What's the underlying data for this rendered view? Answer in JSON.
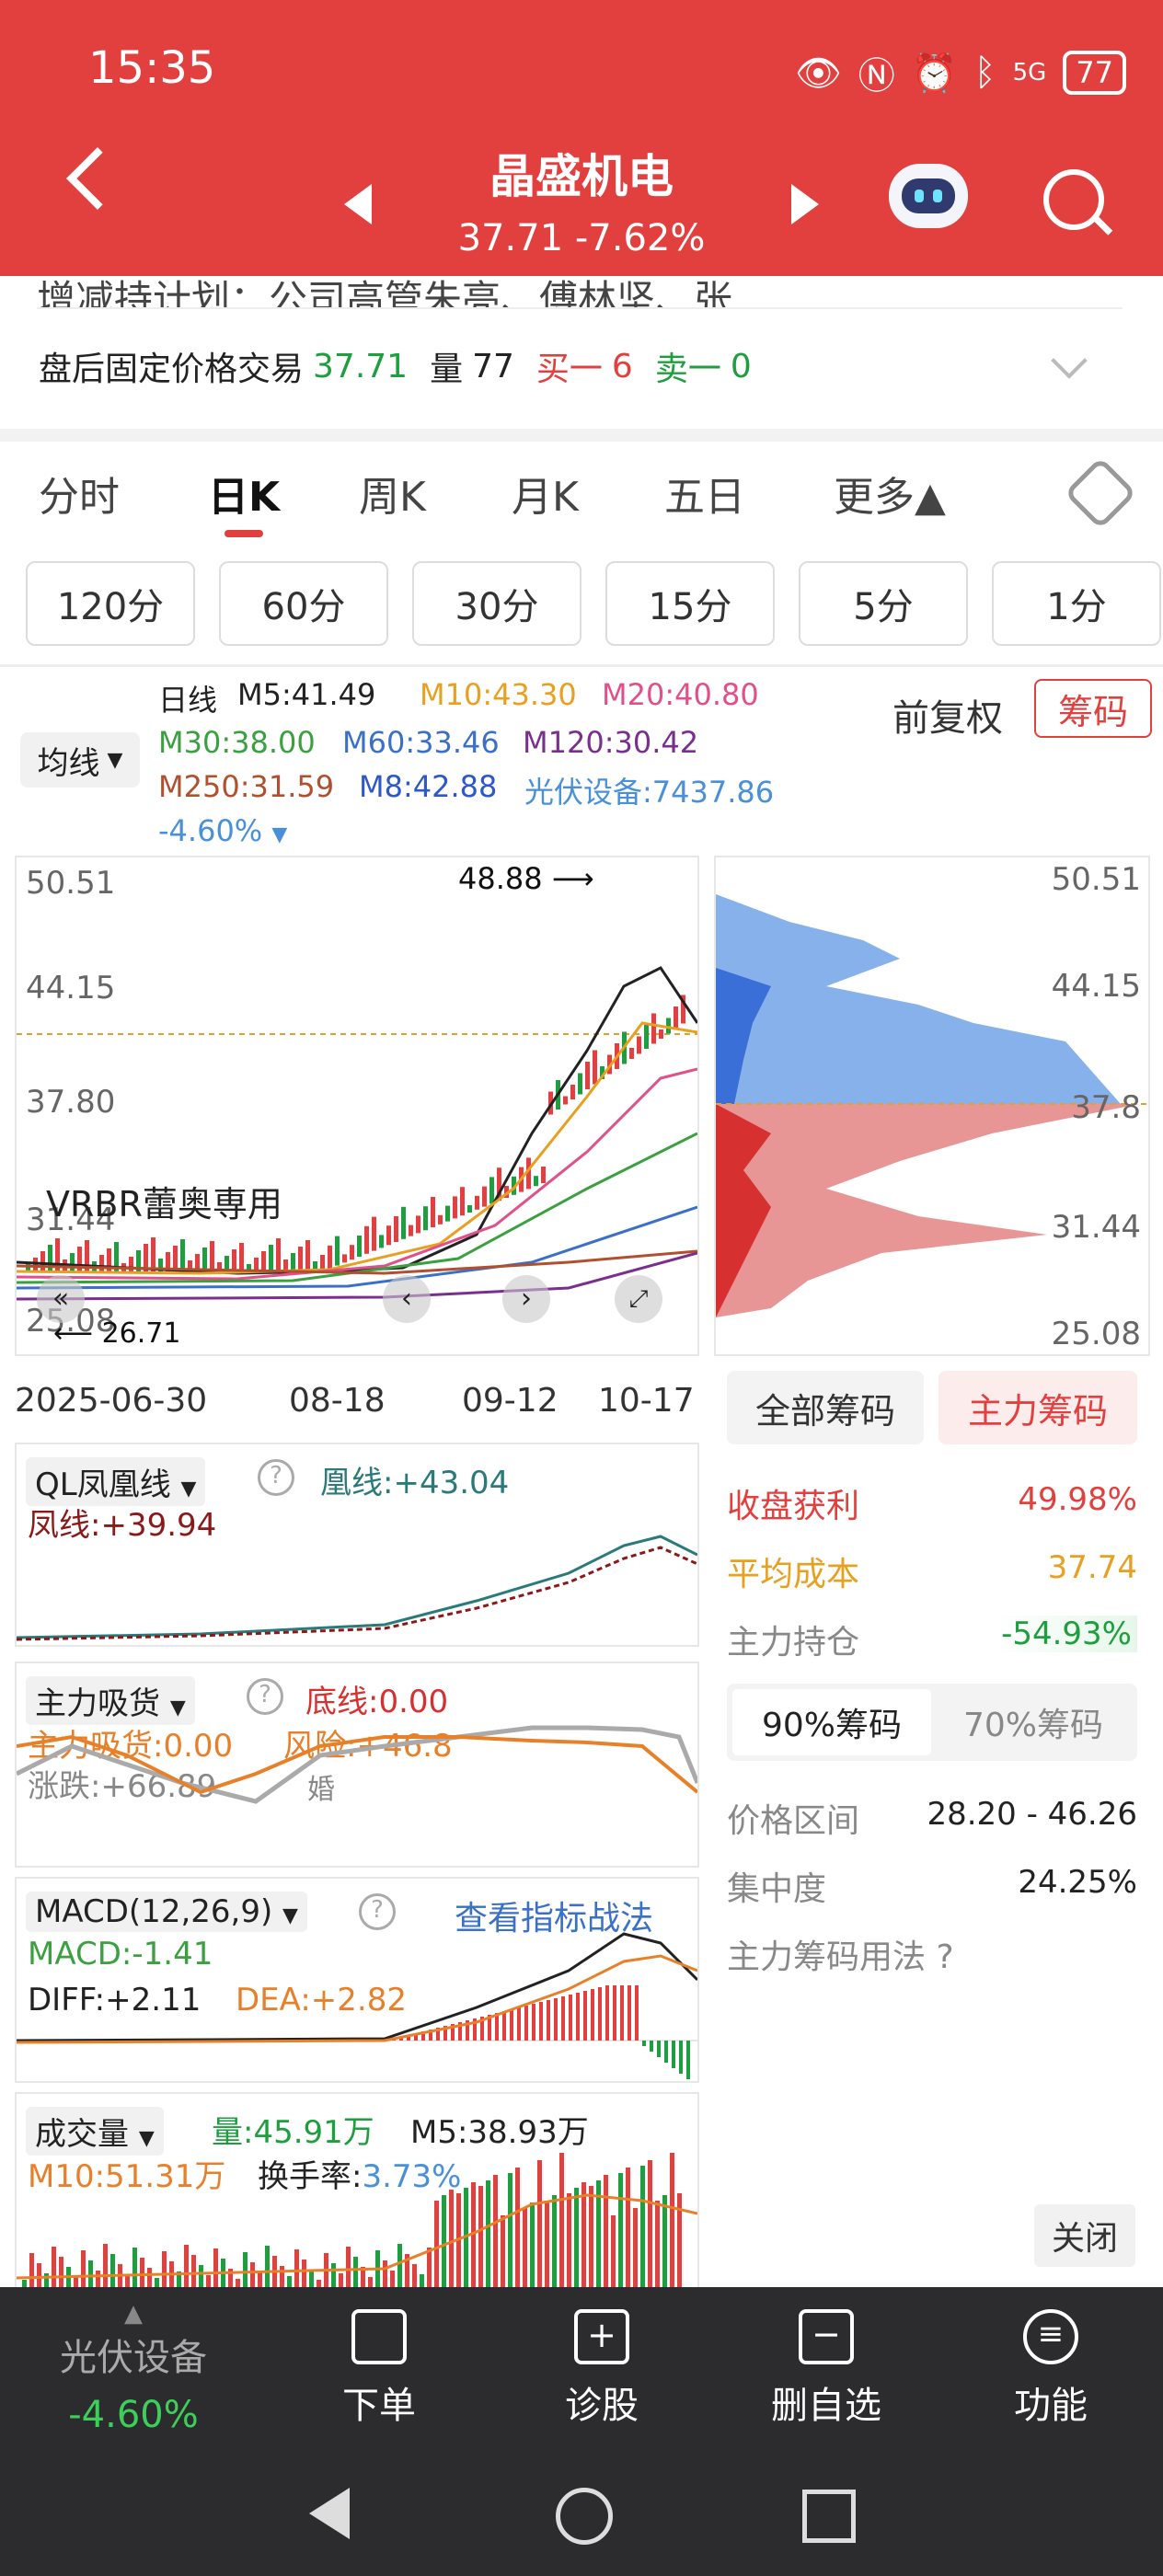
{
  "status": {
    "time": "15:35",
    "battery": "77",
    "signal": "5G"
  },
  "header": {
    "title": "晶盛机电",
    "price_change": "37.71 -7.62%"
  },
  "news": {
    "text": "增减持计划：公司高管朱亮、傅林坚、张..."
  },
  "after_hours": {
    "label": "盘后固定价格交易",
    "price": "37.71",
    "vol_label": "量",
    "vol": "77",
    "buy_label": "买一",
    "buy": "6",
    "sell_label": "卖一",
    "sell": "0"
  },
  "tabs": [
    "分时",
    "日K",
    "周K",
    "月K",
    "五日",
    "更多▲"
  ],
  "minute_buttons": [
    "120分",
    "60分",
    "30分",
    "15分",
    "5分",
    "1分"
  ],
  "ma_selector": "均线",
  "legend": {
    "daily": "日线",
    "m5": "M5:41.49",
    "m10": "M10:43.30",
    "m20": "M20:40.80",
    "m30": "M30:38.00",
    "m60": "M60:33.46",
    "m120": "M120:30.42",
    "m250": "M250:31.59",
    "m8": "M8:42.88",
    "sector": "光伏设备:7437.86",
    "sector_chg": "-4.60%"
  },
  "adjust_label": "前复权",
  "chips_button": "筹码",
  "kline": {
    "y_ticks": [
      "50.51",
      "44.15",
      "37.80",
      "31.44",
      "25.08"
    ],
    "x_ticks": [
      "2025-06-30",
      "08-18",
      "09-12",
      "10-17"
    ],
    "high_label": "48.88",
    "low_label": "26.71",
    "overlay_text": "VRBR蕾奥専用"
  },
  "chip_axis": [
    "50.51",
    "44.15",
    "37.8",
    "31.44",
    "25.08"
  ],
  "phoenix": {
    "name": "QL凤凰线",
    "huang": "凰线:+43.04",
    "feng": "凤线:+39.94"
  },
  "absorb": {
    "name": "主力吸货",
    "bottom": "底线:0.00",
    "value": "主力吸货:0.00",
    "risk": "风险:+46.8",
    "rise": "涨跌:+66.89",
    "extra": "婚"
  },
  "macd": {
    "name": "MACD(12,26,9)",
    "link": "查看指标战法",
    "macd": "MACD:-1.41",
    "diff": "DIFF:+2.11",
    "dea": "DEA:+2.82"
  },
  "volume": {
    "name": "成交量",
    "vol": "量:45.91万",
    "m5": "M5:38.93万",
    "m10": "M10:51.31万",
    "turnover_label": "换手率:",
    "turnover": "3.73%"
  },
  "chip_panel": {
    "tab_all": "全部筹码",
    "tab_main": "主力筹码",
    "profit_label": "收盘获利",
    "profit": "49.98%",
    "avg_label": "平均成本",
    "avg": "37.74",
    "hold_label": "主力持仓",
    "hold": "-54.93%",
    "tab90": "90%筹码",
    "tab70": "70%筹码",
    "range_label": "价格区间",
    "range": "28.20 - 46.26",
    "conc_label": "集中度",
    "conc": "24.25%",
    "usage": "主力筹码用法 ?",
    "close": "关闭"
  },
  "bottom": {
    "sector": "光伏设备",
    "sector_chg": "-4.60%",
    "order": "下单",
    "diagnose": "诊股",
    "remove": "删自选",
    "func": "功能"
  },
  "colors": {
    "brand": "#e2403f",
    "up": "#e2403f",
    "down": "#1e9e3e"
  }
}
